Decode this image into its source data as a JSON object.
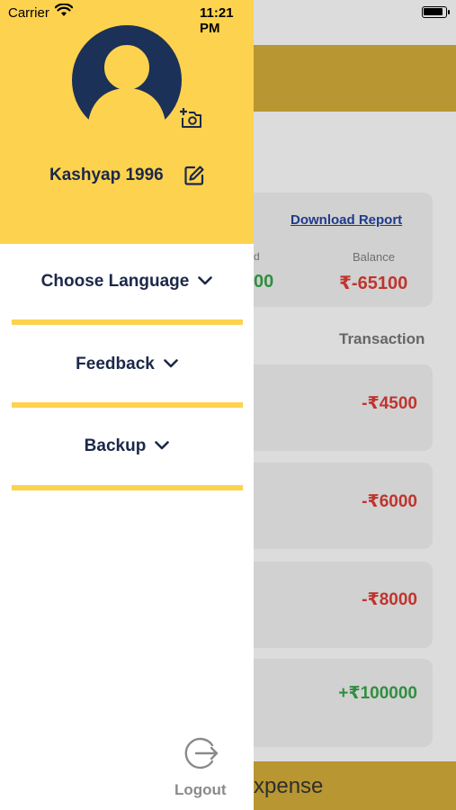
{
  "status_bar": {
    "carrier": "Carrier",
    "time": "11:21 PM"
  },
  "drawer": {
    "username": "Kashyap 1996",
    "menu": [
      {
        "label": "Choose Language"
      },
      {
        "label": "Feedback"
      },
      {
        "label": "Backup"
      }
    ],
    "logout_label": "Logout"
  },
  "background": {
    "download_report": "Download Report",
    "summary": {
      "partial_label": "d",
      "partial_value": "00",
      "balance_label": "Balance",
      "balance_value": "₹-65100"
    },
    "transaction_heading": "Transaction",
    "transactions": [
      {
        "amount": "-₹4500"
      },
      {
        "amount": "-₹6000"
      },
      {
        "amount": "-₹8000"
      },
      {
        "amount": "+₹100000"
      }
    ],
    "footer_label": "xpense"
  },
  "colors": {
    "drawer_accent": "#fdd24e",
    "text_dark_navy": "#1b2849",
    "negative": "#c0342e",
    "positive": "#2f8f3f"
  }
}
